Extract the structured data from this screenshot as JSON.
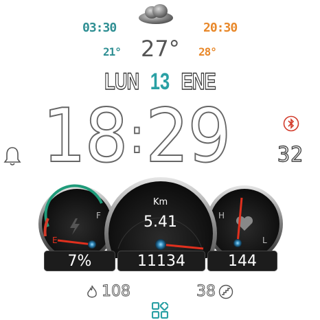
{
  "weather": {
    "sunrise": "03:30",
    "sunset": "20:30",
    "temp_min": "21°",
    "temp_max": "28°",
    "temp_now": "27°",
    "icon": "cloud-icon",
    "colors": {
      "sunrise": "#2f8f93",
      "sunset": "#e8882a",
      "min": "#2f8f93",
      "max": "#e8882a"
    }
  },
  "date": {
    "weekday": "LUN",
    "day": "13",
    "month": "ENE"
  },
  "time": {
    "hours": "18",
    "separator": ":",
    "minutes": "29",
    "seconds": "32"
  },
  "gauges": {
    "battery": {
      "percent_text": "7%",
      "high_label": "F",
      "low_label": "E",
      "level": 0.07
    },
    "distance": {
      "unit": "Km",
      "value": "5.41",
      "steps": "11134"
    },
    "heart": {
      "bpm": "144",
      "high_label": "H",
      "low_label": "L"
    }
  },
  "bottom": {
    "calories": "108",
    "floors": "38"
  },
  "colors": {
    "accent": "#2aa0a4",
    "needle": "#e0301e",
    "bluetooth": "#d23a2a"
  }
}
